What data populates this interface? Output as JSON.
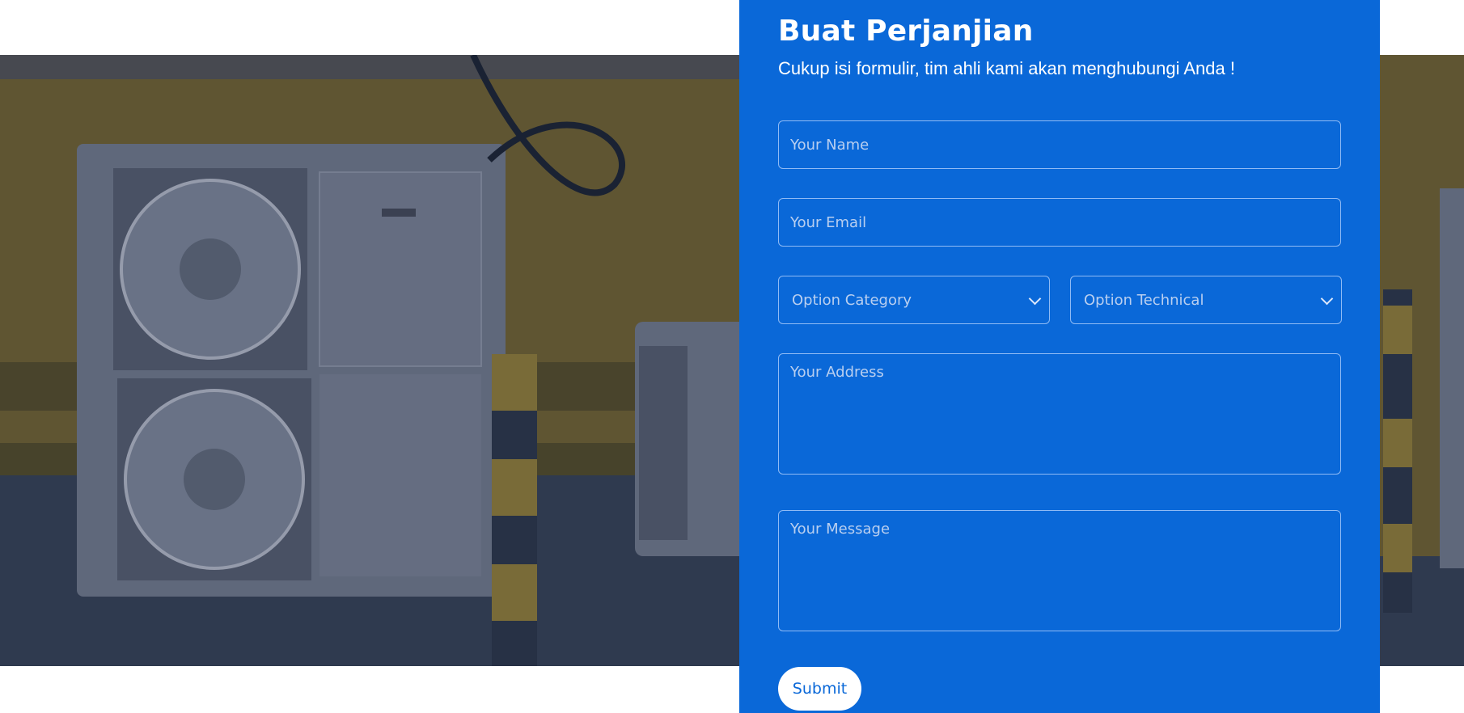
{
  "form": {
    "title": "Buat Perjanjian",
    "subtitle": "Cukup isi formulir, tim ahli kami akan menghubungi Anda !",
    "name_placeholder": "Your Name",
    "email_placeholder": "Your Email",
    "category_select": "Option Category",
    "technical_select": "Option Technical",
    "address_placeholder": "Your Address",
    "message_placeholder": "Your Message",
    "submit_label": "Submit"
  },
  "colors": {
    "panel_background": "#0a68d8",
    "text": "#ffffff",
    "placeholder": "#b9cff0",
    "submit_background": "#ffffff",
    "submit_text": "#0a68d8"
  },
  "icons": {
    "select_arrow": "chevron-down-icon"
  },
  "image": {
    "subject": "outdoor air conditioner units"
  }
}
